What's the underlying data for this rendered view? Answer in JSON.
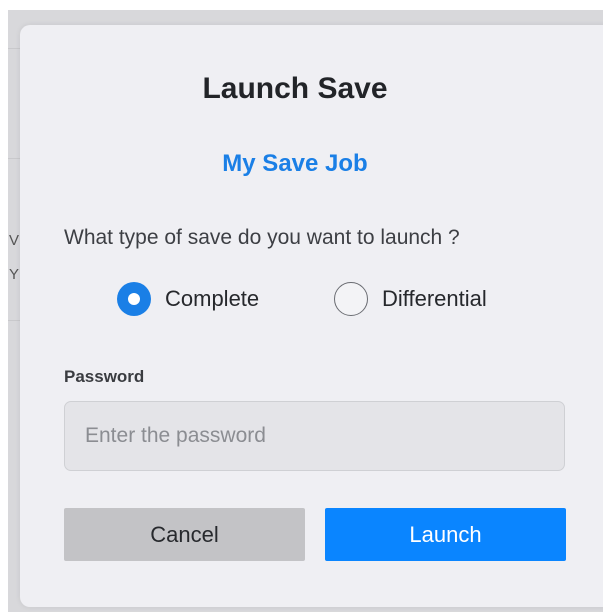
{
  "dialog": {
    "title": "Launch Save",
    "job_name": "My Save Job",
    "question": "What type of save do you want to launch ?",
    "save_types": [
      {
        "label": "Complete",
        "selected": true
      },
      {
        "label": "Differential",
        "selected": false
      }
    ],
    "password": {
      "label": "Password",
      "placeholder": "Enter the password",
      "value": ""
    },
    "buttons": {
      "cancel": "Cancel",
      "launch": "Launch"
    }
  },
  "background": {
    "partial_letters": [
      "V",
      "Y"
    ]
  },
  "colors": {
    "accent": "#1a7fe6",
    "launch_button": "#0a85ff",
    "cancel_button": "#c3c3c6",
    "dialog_bg": "#efeff3"
  }
}
